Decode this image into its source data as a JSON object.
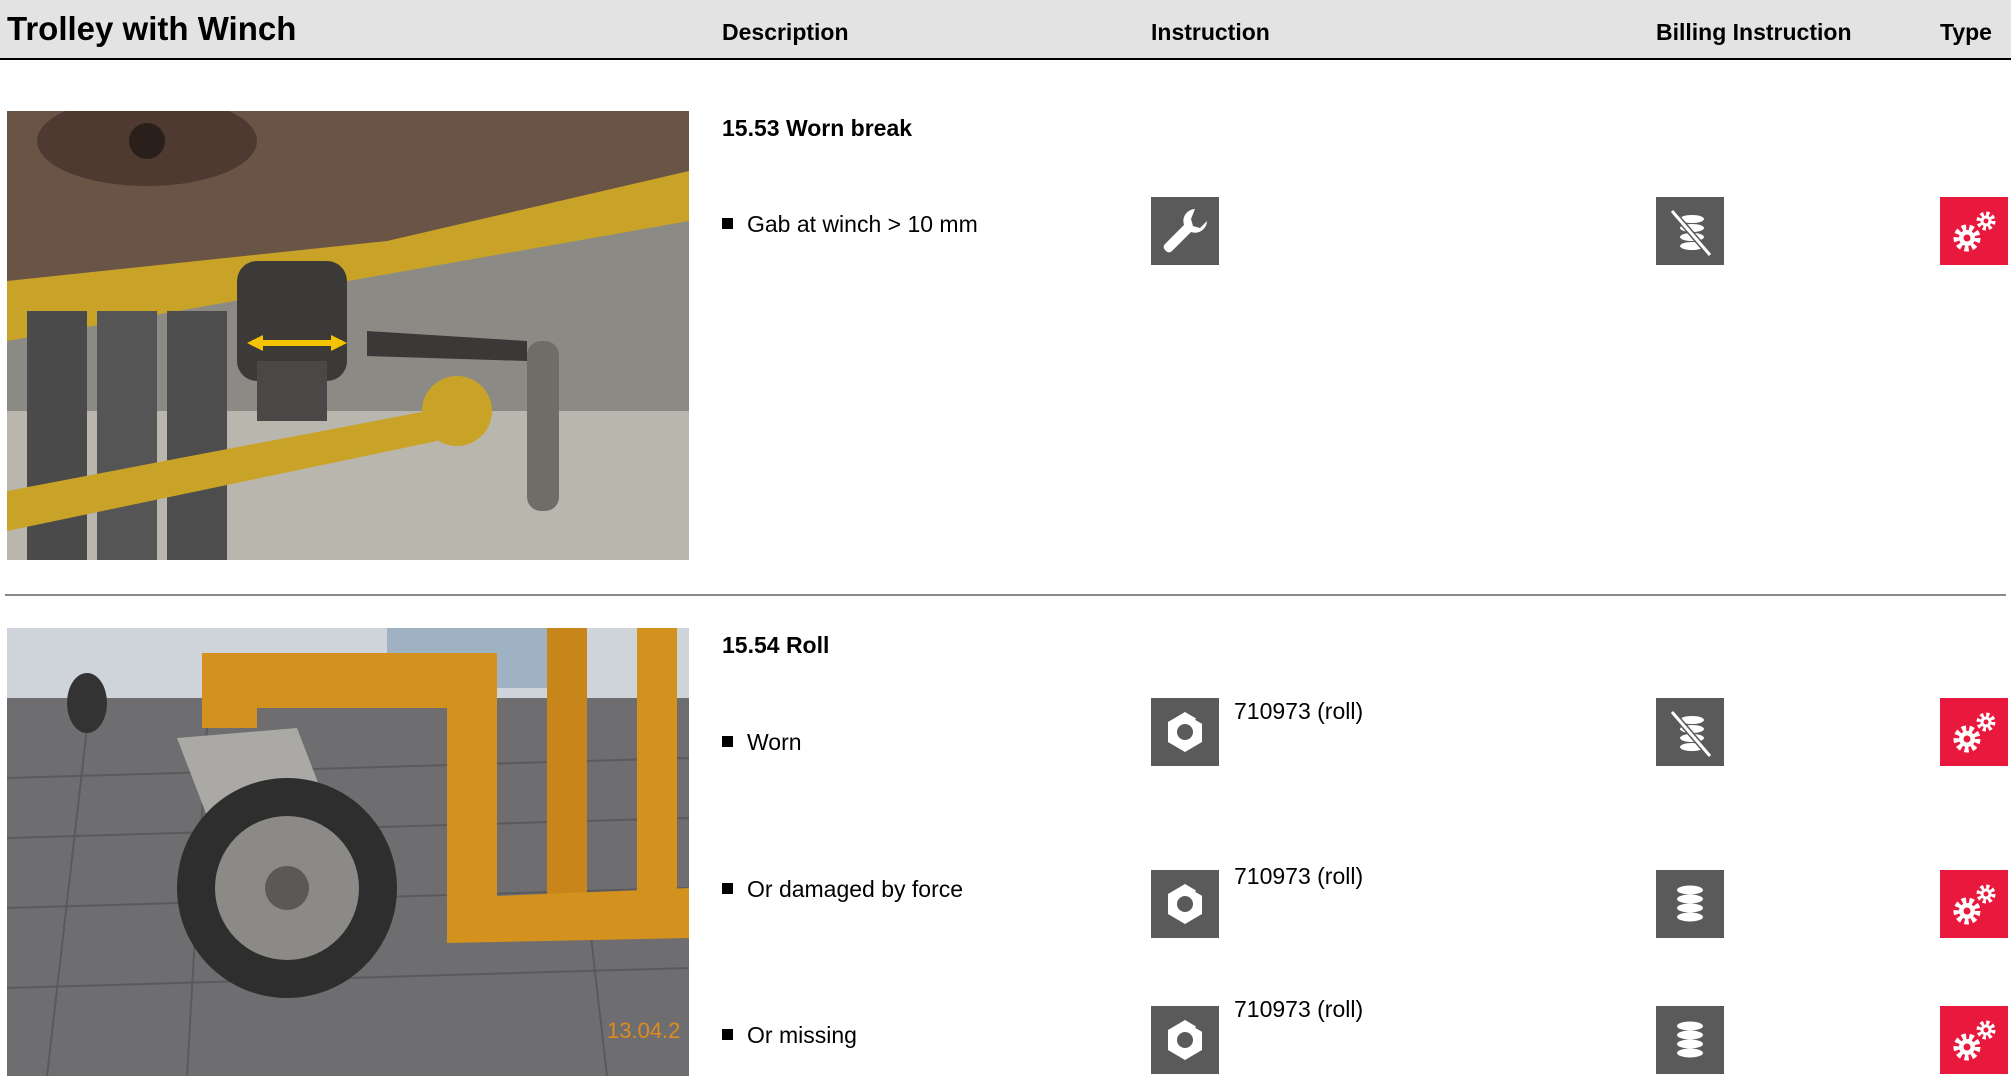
{
  "header": {
    "title": "Trolley with Winch",
    "columns": [
      "Description",
      "Instruction",
      "Billing Instruction",
      "Type"
    ]
  },
  "sections": [
    {
      "title": "15.53 Worn break",
      "photo": "winch-brake-photo",
      "items": [
        {
          "text": "Gab at winch > 10 mm",
          "instruction_icon": "wrench-icon",
          "part": "",
          "billing_icon": "no-billing-coins-icon",
          "type_icon": "gears-icon"
        }
      ]
    },
    {
      "title": "15.54 Roll",
      "photo": "trolley-wheel-photo",
      "photo_date_stamp": "13.04.2",
      "items": [
        {
          "text": "Worn",
          "instruction_icon": "nut-icon",
          "part": "710973 (roll)",
          "billing_icon": "no-billing-coins-icon",
          "type_icon": "gears-icon"
        },
        {
          "text": "Or damaged by force",
          "instruction_icon": "nut-icon",
          "part": "710973 (roll)",
          "billing_icon": "billing-coins-icon",
          "type_icon": "gears-icon"
        },
        {
          "text": "Or missing",
          "instruction_icon": "nut-icon",
          "part": "710973 (roll)",
          "billing_icon": "billing-coins-icon",
          "type_icon": "gears-icon"
        }
      ]
    }
  ],
  "colors": {
    "header_bg": "#e3e3e3",
    "icon_grey": "#5a5a5a",
    "type_red": "#e8193c"
  }
}
